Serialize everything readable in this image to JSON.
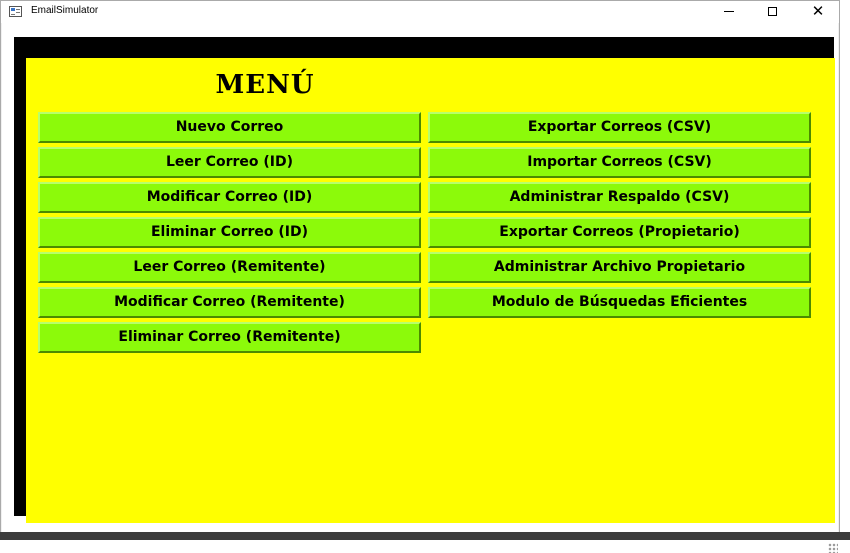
{
  "window": {
    "title": "EmailSimulator",
    "controls": {
      "minimize": "–",
      "maximize": "☐",
      "close": "✕"
    }
  },
  "menu": {
    "title": "MENÚ",
    "left_buttons": [
      "Nuevo Correo",
      "Leer Correo (ID)",
      "Modificar Correo (ID)",
      "Eliminar Correo (ID)",
      "Leer Correo (Remitente)",
      "Modificar Correo (Remitente)",
      "Eliminar Correo (Remitente)"
    ],
    "right_buttons": [
      "Exportar Correos (CSV)",
      "Importar Correos (CSV)",
      "Administrar Respaldo (CSV)",
      "Exportar Correos (Propietario)",
      "Administrar Archivo Propietario",
      "Modulo de Búsquedas Eficientes"
    ]
  },
  "colors": {
    "panel_background": "#ffff00",
    "button_background": "#8cfa0a",
    "frame_border": "#000000"
  },
  "icons": {
    "app": "window-app-icon",
    "minimize": "minimize-icon",
    "maximize": "maximize-icon",
    "close": "close-icon"
  }
}
